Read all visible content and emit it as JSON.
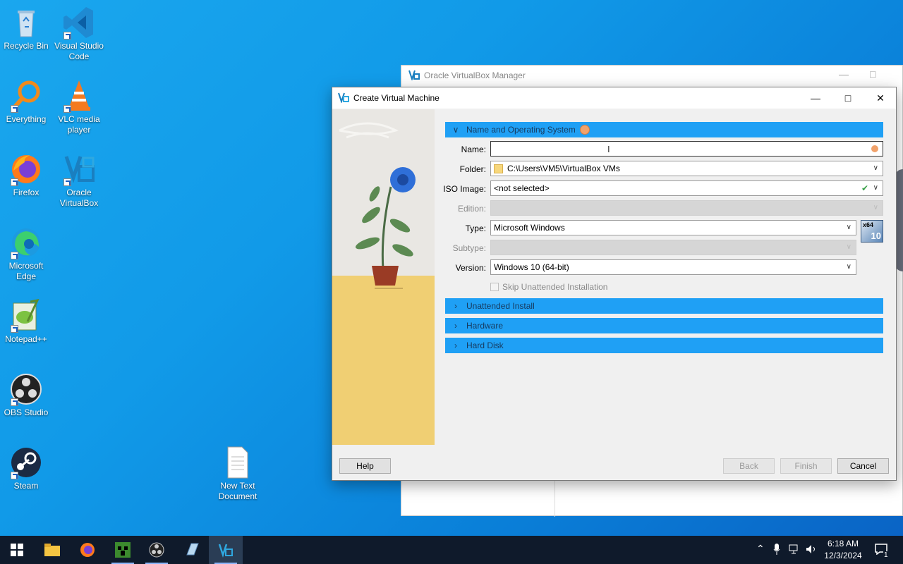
{
  "desktop": {
    "icons": [
      {
        "label": "Recycle Bin"
      },
      {
        "label": "Visual Studio Code"
      },
      {
        "label": "Everything"
      },
      {
        "label": "VLC media player"
      },
      {
        "label": "Firefox"
      },
      {
        "label": "Oracle VirtualBox"
      },
      {
        "label": "Microsoft Edge"
      },
      {
        "label": "Notepad++"
      },
      {
        "label": "OBS Studio"
      },
      {
        "label": "Steam"
      },
      {
        "label": "New Text Document"
      }
    ]
  },
  "back_window": {
    "title": "Oracle VirtualBox Manager"
  },
  "dialog": {
    "title": "Create Virtual Machine",
    "sections": {
      "name_os": "Name and Operating System",
      "unattended": "Unattended Install",
      "hardware": "Hardware",
      "hard_disk": "Hard Disk"
    },
    "fields": {
      "name_label": "Name:",
      "name_value": "",
      "folder_label": "Folder:",
      "folder_value": "C:\\Users\\VM5\\VirtualBox VMs",
      "iso_label": "ISO Image:",
      "iso_value": "<not selected>",
      "edition_label": "Edition:",
      "type_label": "Type:",
      "type_value": "Microsoft Windows",
      "subtype_label": "Subtype:",
      "version_label": "Version:",
      "version_value": "Windows 10 (64-bit)",
      "skip_label": "Skip Unattended Installation",
      "os_badge_top": "x64",
      "os_badge_bottom": "10"
    },
    "buttons": {
      "help": "Help",
      "back": "Back",
      "finish": "Finish",
      "cancel": "Cancel"
    }
  },
  "taskbar": {
    "time": "6:18 AM",
    "date": "12/3/2024",
    "notification_count": "1"
  },
  "colors": {
    "section_bar": "#1fa0f5",
    "desktop_blue": "#119ae8",
    "taskbar": "#0f1a2b"
  }
}
